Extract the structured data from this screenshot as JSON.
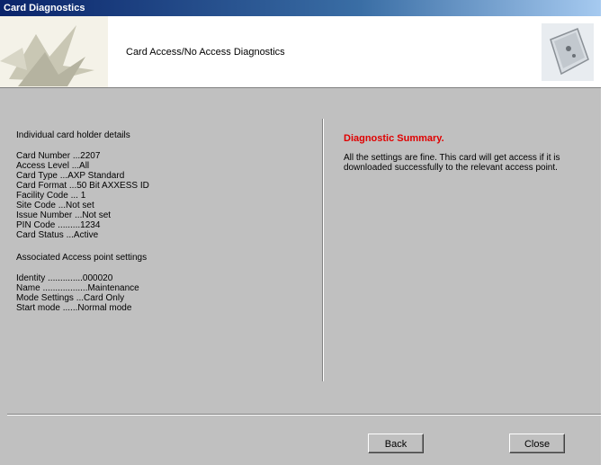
{
  "window": {
    "title": "Card Diagnostics"
  },
  "header": {
    "title": "Card Access/No Access Diagnostics"
  },
  "details": {
    "section_title": "Individual card holder details",
    "rows": [
      {
        "key": "Card Number",
        "value": "...2207"
      },
      {
        "key": "Access Level",
        "value": "...All"
      },
      {
        "key": "Card Type",
        "value": "...AXP Standard"
      },
      {
        "key": "Card Format",
        "value": "...50 Bit AXXESS ID"
      },
      {
        "key": "Facility Code",
        "value": "... 1"
      },
      {
        "key": "Site Code",
        "value": "...Not set"
      },
      {
        "key": "Issue Number",
        "value": "...Not set"
      },
      {
        "key": "PIN Code",
        "value": ".........1234"
      },
      {
        "key": "Card Status",
        "value": "...Active"
      }
    ]
  },
  "access_point": {
    "section_title": "Associated Access point settings",
    "rows": [
      {
        "key": "Identity",
        "value": "..............000020"
      },
      {
        "key": "Name",
        "value": "..................Maintenance"
      },
      {
        "key": "Mode Settings",
        "value": "...Card Only"
      },
      {
        "key": "Start mode",
        "value": "......Normal mode"
      }
    ]
  },
  "summary": {
    "title": "Diagnostic Summary.",
    "text": "All the settings are fine. This card will get access if it is downloaded successfully to the relevant access point."
  },
  "buttons": {
    "back": "Back",
    "close": "Close"
  }
}
